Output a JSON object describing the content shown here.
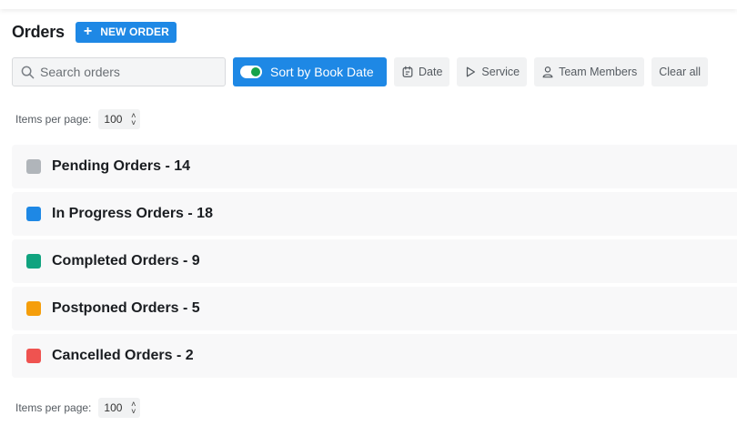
{
  "header": {
    "title": "Orders",
    "new_order_label": "NEW ORDER"
  },
  "toolbar": {
    "search_placeholder": "Search orders",
    "sort_label": "Sort by Book Date",
    "sort_enabled": true,
    "filters": {
      "date": "Date",
      "service": "Service",
      "team_members": "Team Members",
      "clear_all": "Clear all"
    }
  },
  "pagination_top": {
    "label": "Items per page:",
    "value": "100"
  },
  "pagination_bottom": {
    "label": "Items per page:",
    "value": "100"
  },
  "groups": [
    {
      "label": "Pending Orders - 14",
      "color": "#b0b5ba"
    },
    {
      "label": "In Progress Orders - 18",
      "color": "#1e88e5"
    },
    {
      "label": "Completed Orders - 9",
      "color": "#10a37f"
    },
    {
      "label": "Postponed Orders - 5",
      "color": "#f59e0b"
    },
    {
      "label": "Cancelled Orders - 2",
      "color": "#ef5350"
    }
  ],
  "colors": {
    "accent": "#1e88e5",
    "toggle_on": "#16a34a"
  }
}
